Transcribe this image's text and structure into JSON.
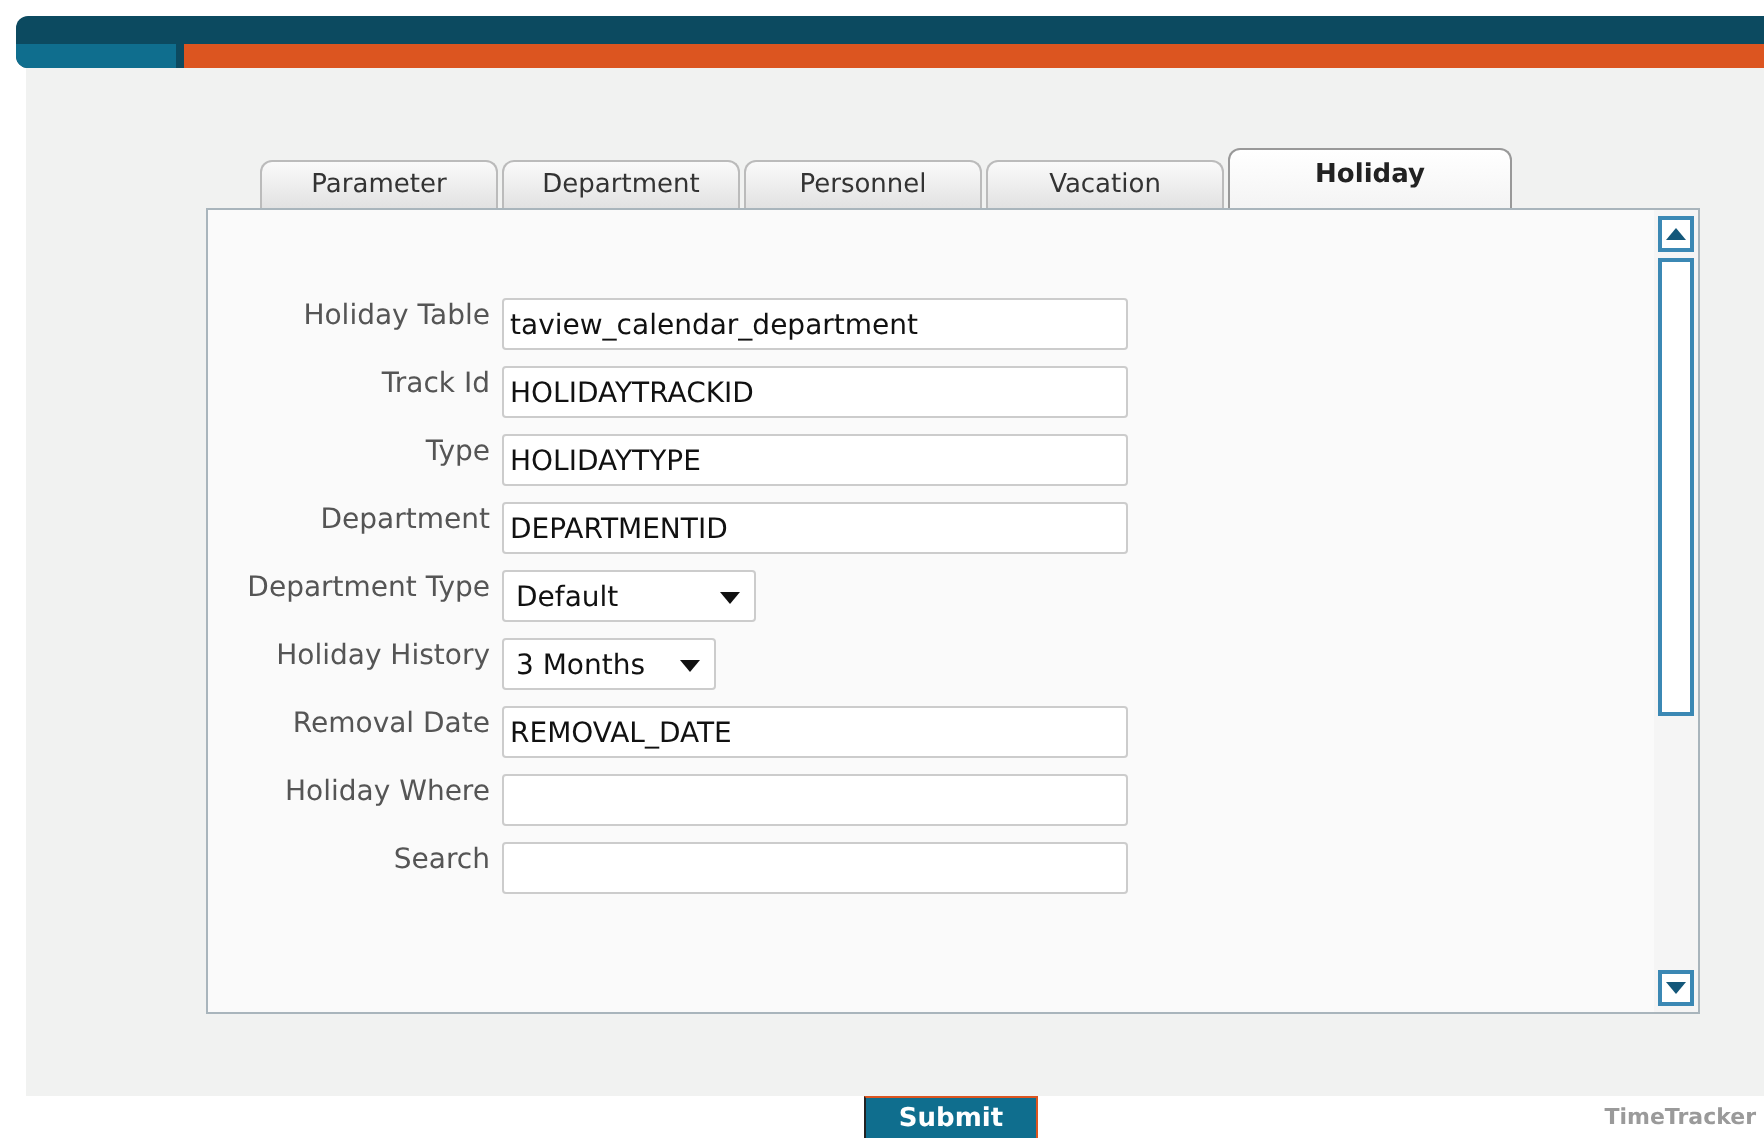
{
  "tabs": [
    {
      "label": "Parameter",
      "selected": false
    },
    {
      "label": "Department",
      "selected": false
    },
    {
      "label": "Personnel",
      "selected": false
    },
    {
      "label": "Vacation",
      "selected": false
    },
    {
      "label": "Holiday",
      "selected": true
    }
  ],
  "fields": [
    {
      "kind": "text",
      "label": "Holiday Table",
      "value": "taview_calendar_department"
    },
    {
      "kind": "text",
      "label": "Track Id",
      "value": "HOLIDAYTRACKID"
    },
    {
      "kind": "text",
      "label": "Type",
      "value": "HOLIDAYTYPE"
    },
    {
      "kind": "text",
      "label": "Department",
      "value": "DEPARTMENTID"
    },
    {
      "kind": "select",
      "label": "Department Type",
      "value": "Default"
    },
    {
      "kind": "select",
      "label": "Holiday History",
      "value": "3 Months"
    },
    {
      "kind": "text",
      "label": "Removal Date",
      "value": "REMOVAL_DATE"
    },
    {
      "kind": "text",
      "label": "Holiday Where"
    },
    {
      "kind": "text",
      "label": "Search"
    }
  ],
  "submit_button": "Submit",
  "footer_brand": "TimeTracker"
}
